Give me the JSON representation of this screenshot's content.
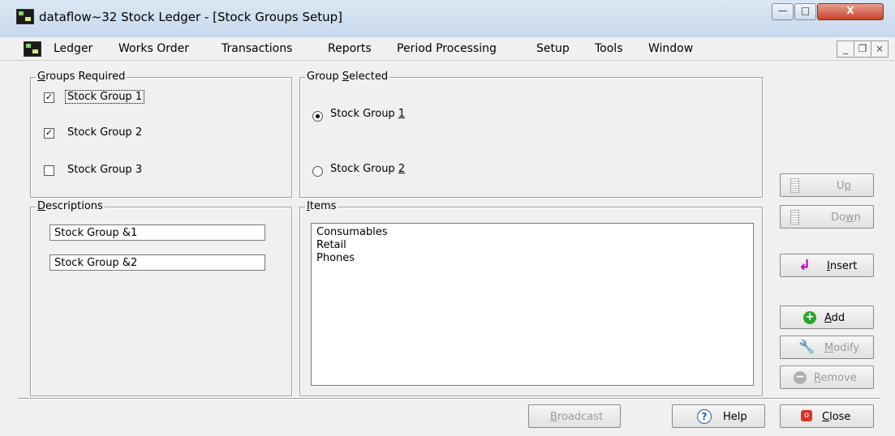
{
  "window": {
    "title": "dataflow~32 Stock Ledger - [Stock Groups Setup]",
    "controls": {
      "minimize": "—",
      "maximize": "□",
      "close": "X"
    }
  },
  "menu": {
    "items": [
      "Ledger",
      "Works Order",
      "Transactions",
      "Reports",
      "Period Processing",
      "Setup",
      "Tools",
      "Window"
    ],
    "mdi_controls": {
      "minimize": "_",
      "restore": "❐",
      "close": "×"
    }
  },
  "groups_required": {
    "legend_prefix": "",
    "legend_hotkey": "G",
    "legend_rest": "roups Required",
    "options": [
      {
        "label": "Stock Group 1",
        "checked": true
      },
      {
        "label": "Stock Group 2",
        "checked": true
      },
      {
        "label": "Stock Group 3",
        "checked": false
      }
    ]
  },
  "group_selected": {
    "legend_prefix": "Group ",
    "legend_hotkey": "S",
    "legend_rest": "elected",
    "options": [
      {
        "label_prefix": "Stock Group ",
        "label_hotkey": "1",
        "selected": true
      },
      {
        "label_prefix": "Stock Group ",
        "label_hotkey": "2",
        "selected": false
      }
    ]
  },
  "descriptions": {
    "legend_hotkey": "D",
    "legend_rest": "escriptions",
    "fields": [
      "Stock Group &1",
      "Stock Group &2"
    ]
  },
  "items": {
    "legend_hotkey": "I",
    "legend_rest": "tems",
    "list": [
      "Consumables",
      "Retail",
      "Phones"
    ]
  },
  "buttons": {
    "up": {
      "pre": "U",
      "hot": "p",
      "post": ""
    },
    "down": {
      "pre": "Do",
      "hot": "w",
      "post": "n"
    },
    "insert": {
      "pre": "",
      "hot": "I",
      "post": "nsert"
    },
    "add": {
      "pre": "",
      "hot": "A",
      "post": "dd"
    },
    "modify": {
      "pre": "",
      "hot": "M",
      "post": "odify"
    },
    "remove": {
      "pre": "",
      "hot": "R",
      "post": "emove"
    },
    "broadcast": {
      "pre": "",
      "hot": "B",
      "post": "roadcast"
    },
    "help": {
      "pre": "Help",
      "hot": "",
      "post": ""
    },
    "close": {
      "pre": "",
      "hot": "C",
      "post": "lose"
    }
  },
  "colors": {
    "add_icon": "#2aa52a",
    "insert_arrow": "#c400c4",
    "close_icon": "#d8352a",
    "help_icon": "#1f5fbf"
  }
}
